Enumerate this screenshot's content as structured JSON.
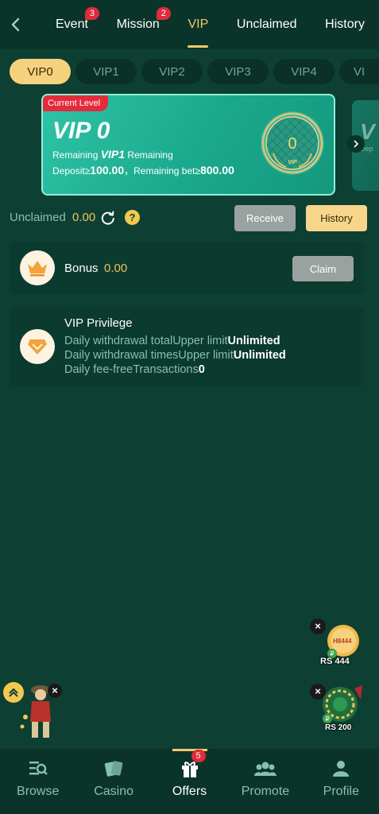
{
  "header": {
    "tabs": [
      {
        "label": "Event",
        "badge": "3",
        "active": false
      },
      {
        "label": "Mission",
        "badge": "2",
        "active": false
      },
      {
        "label": "VIP",
        "badge": "",
        "active": true
      },
      {
        "label": "Unclaimed",
        "badge": "",
        "active": false
      },
      {
        "label": "History",
        "badge": "",
        "active": false
      }
    ]
  },
  "levels": [
    "VIP0",
    "VIP1",
    "VIP2",
    "VIP3",
    "VIP4",
    "VI"
  ],
  "card": {
    "tag": "Current Level",
    "title": "VIP 0",
    "line1_a": "Remaining ",
    "line1_b": "VIP1",
    "line1_c": " Remaining",
    "line2_a": "Deposit≥",
    "line2_b": "100.00",
    "line2_c": "，Remaining bet≥",
    "line2_d": "800.00",
    "medal_number": "0",
    "medal_text": "VIP",
    "next_title": "V",
    "next_sub": "Dep"
  },
  "unclaimed": {
    "label": "Unclaimed",
    "value": "0.00",
    "help": "?",
    "receive_label": "Receive",
    "history_label": "History"
  },
  "bonus": {
    "label": "Bonus",
    "value": "0.00",
    "claim_label": "Claim"
  },
  "privilege": {
    "title": "VIP Privilege",
    "rows": [
      {
        "label": "Daily withdrawal totalUpper limit",
        "value": "Unlimited"
      },
      {
        "label": "Daily withdrawal timesUpper limit",
        "value": "Unlimited"
      },
      {
        "label": "Daily fee-freeTransactions",
        "value": "0"
      }
    ]
  },
  "floating": {
    "promo1_label": "RS 444",
    "promo1_text": "H8444",
    "promo2_label": "RS 200",
    "close": "×"
  },
  "bottom_nav": [
    {
      "label": "Browse",
      "active": false,
      "badge": ""
    },
    {
      "label": "Casino",
      "active": false,
      "badge": ""
    },
    {
      "label": "Offers",
      "active": true,
      "badge": "5"
    },
    {
      "label": "Promote",
      "active": false,
      "badge": ""
    },
    {
      "label": "Profile",
      "active": false,
      "badge": ""
    }
  ],
  "colors": {
    "background": "#0e3f33",
    "accent": "#f3c96b",
    "badge": "#e02b3a",
    "card": "#1fb497"
  }
}
